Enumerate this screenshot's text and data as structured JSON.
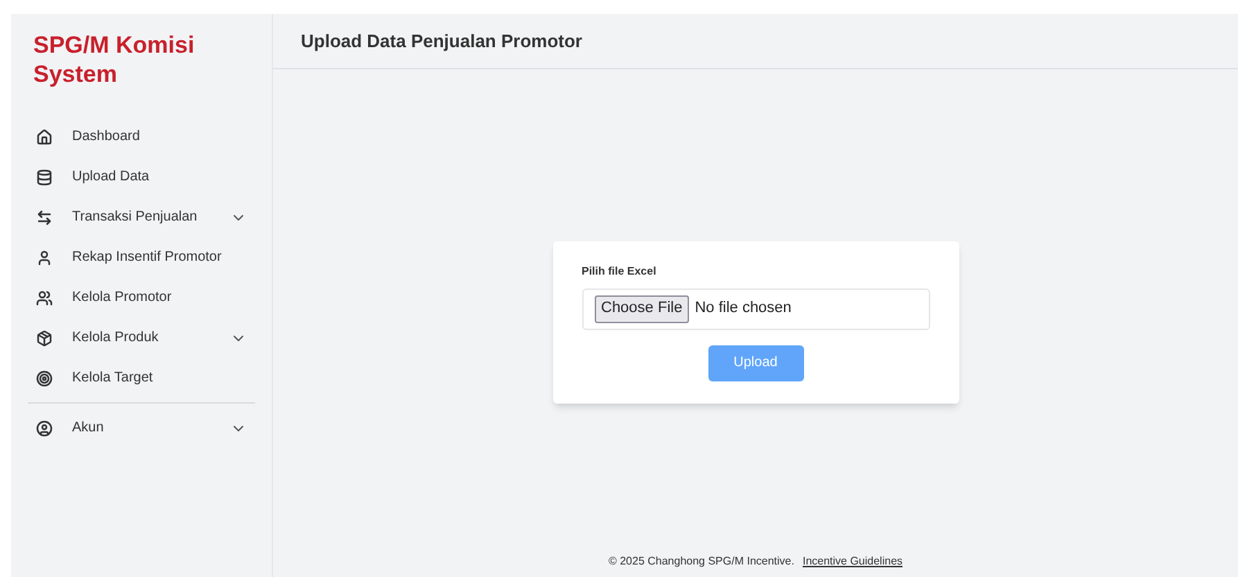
{
  "sidebar": {
    "brand": "SPG/M Komisi System",
    "items": [
      {
        "label": "Dashboard",
        "has_submenu": false
      },
      {
        "label": "Upload Data",
        "has_submenu": false
      },
      {
        "label": "Transaksi Penjualan",
        "has_submenu": true
      },
      {
        "label": "Rekap Insentif Promotor",
        "has_submenu": false
      },
      {
        "label": "Kelola Promotor",
        "has_submenu": false
      },
      {
        "label": "Kelola Produk",
        "has_submenu": true
      },
      {
        "label": "Kelola Target",
        "has_submenu": false
      }
    ],
    "account_items": [
      {
        "label": "Akun",
        "has_submenu": true
      }
    ]
  },
  "header": {
    "title": "Upload Data Penjualan Promotor"
  },
  "upload_form": {
    "label": "Pilih file Excel",
    "file_button": "Choose File",
    "file_status": "No file chosen",
    "submit": {
      "label": "Upload",
      "disabled": true
    }
  },
  "footer": {
    "text": "© 2025 Changhong SPG/M Incentive.",
    "link": "Incentive Guidelines"
  }
}
